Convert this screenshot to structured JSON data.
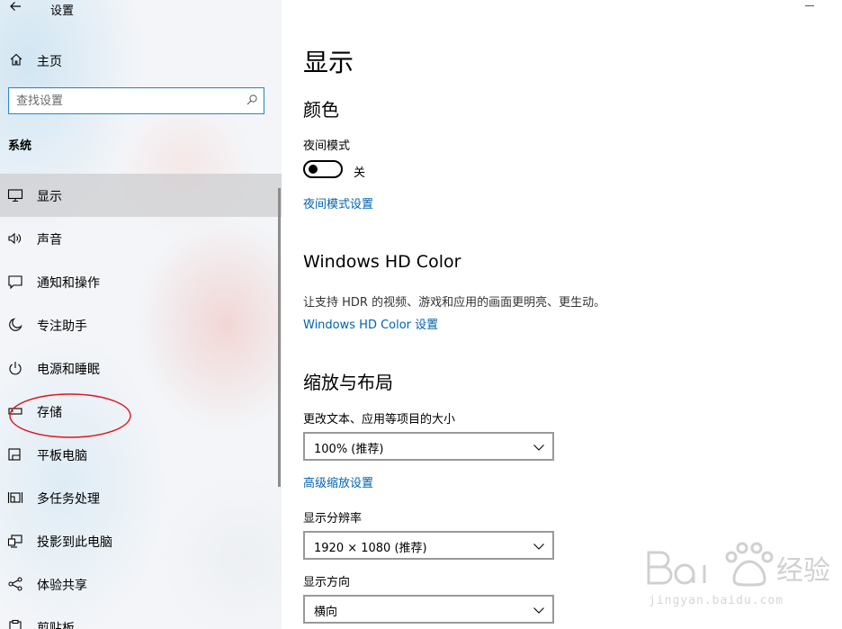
{
  "window": {
    "title": "设置",
    "back_icon": "arrow-left-icon",
    "minimize_icon": "minimize-icon"
  },
  "sidebar": {
    "home_label": "主页",
    "search_placeholder": "查找设置",
    "section_label": "系统",
    "items": [
      {
        "label": "显示",
        "icon": "monitor-icon",
        "selected": true
      },
      {
        "label": "声音",
        "icon": "speaker-icon",
        "selected": false
      },
      {
        "label": "通知和操作",
        "icon": "notification-icon",
        "selected": false
      },
      {
        "label": "专注助手",
        "icon": "moon-icon",
        "selected": false
      },
      {
        "label": "电源和睡眠",
        "icon": "power-icon",
        "selected": false
      },
      {
        "label": "存储",
        "icon": "storage-icon",
        "selected": false
      },
      {
        "label": "平板电脑",
        "icon": "tablet-icon",
        "selected": false
      },
      {
        "label": "多任务处理",
        "icon": "multitask-icon",
        "selected": false
      },
      {
        "label": "投影到此电脑",
        "icon": "project-icon",
        "selected": false
      },
      {
        "label": "体验共享",
        "icon": "share-icon",
        "selected": false
      },
      {
        "label": "剪贴板",
        "icon": "clipboard-icon",
        "selected": false
      }
    ],
    "annotation_color": "#e0141e"
  },
  "main": {
    "title": "显示",
    "color_section": {
      "heading": "颜色",
      "night_mode_label": "夜间模式",
      "night_mode_state": "关",
      "night_mode_on": false,
      "night_mode_settings_link": "夜间模式设置"
    },
    "hdr_section": {
      "heading": "Windows HD Color",
      "description": "让支持 HDR 的视频、游戏和应用的画面更明亮、更生动。",
      "link": "Windows HD Color 设置"
    },
    "scale_section": {
      "heading": "缩放与布局",
      "scale_label": "更改文本、应用等项目的大小",
      "scale_value": "100% (推荐)",
      "advanced_scaling_link": "高级缩放设置",
      "resolution_label": "显示分辨率",
      "resolution_value": "1920 × 1080 (推荐)",
      "orientation_label": "显示方向",
      "orientation_value": "横向"
    },
    "link_color": "#0063b1"
  },
  "watermark": {
    "brand": "Bai 经验",
    "url": "jingyan.baidu.com"
  }
}
